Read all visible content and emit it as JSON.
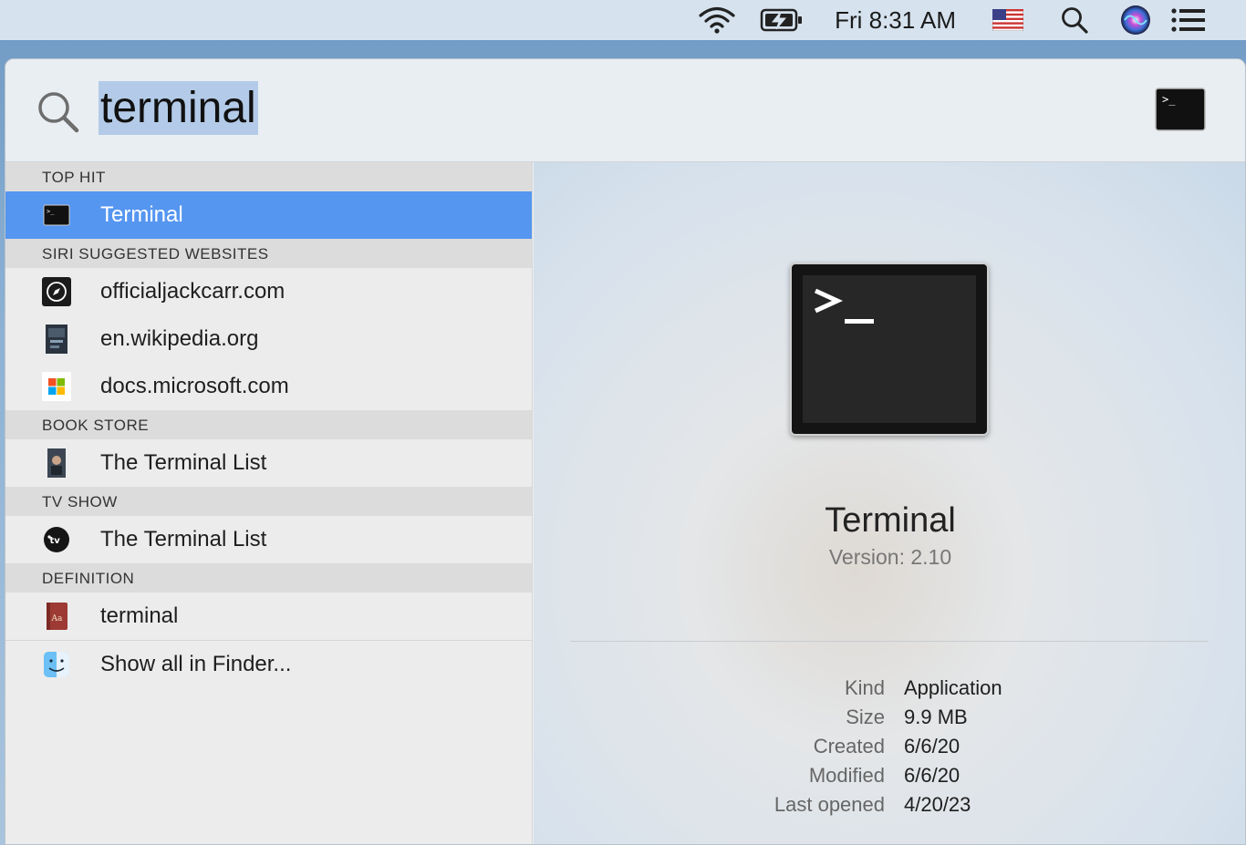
{
  "menubar": {
    "clock": "Fri 8:31 AM",
    "icons": [
      "wifi-icon",
      "battery-charging-icon",
      "us-flag-input-icon",
      "spotlight-search-icon",
      "siri-icon",
      "notification-center-icon"
    ]
  },
  "search": {
    "query": "terminal"
  },
  "results": {
    "sections": [
      {
        "header": "TOP HIT",
        "items": [
          {
            "label": "Terminal",
            "icon": "terminal-app-icon",
            "selected": true
          }
        ]
      },
      {
        "header": "SIRI SUGGESTED WEBSITES",
        "items": [
          {
            "label": "officialjackcarr.com",
            "icon": "safari-compass-icon"
          },
          {
            "label": "en.wikipedia.org",
            "icon": "website-thumbnail-icon"
          },
          {
            "label": "docs.microsoft.com",
            "icon": "microsoft-logo-icon"
          }
        ]
      },
      {
        "header": "BOOK STORE",
        "items": [
          {
            "label": "The Terminal List",
            "icon": "book-cover-icon"
          }
        ]
      },
      {
        "header": "TV SHOW",
        "items": [
          {
            "label": "The Terminal List",
            "icon": "apple-tv-icon"
          }
        ]
      },
      {
        "header": "DEFINITION",
        "items": [
          {
            "label": "terminal",
            "icon": "dictionary-icon"
          }
        ]
      }
    ],
    "show_all": "Show all in Finder..."
  },
  "preview": {
    "name": "Terminal",
    "version": "Version: 2.10",
    "meta": [
      {
        "key": "Kind",
        "value": "Application"
      },
      {
        "key": "Size",
        "value": "9.9 MB"
      },
      {
        "key": "Created",
        "value": "6/6/20"
      },
      {
        "key": "Modified",
        "value": "6/6/20"
      },
      {
        "key": "Last opened",
        "value": "4/20/23"
      }
    ]
  },
  "colors": {
    "selection": "#5596f0",
    "query_highlight": "#b3cbe8"
  }
}
